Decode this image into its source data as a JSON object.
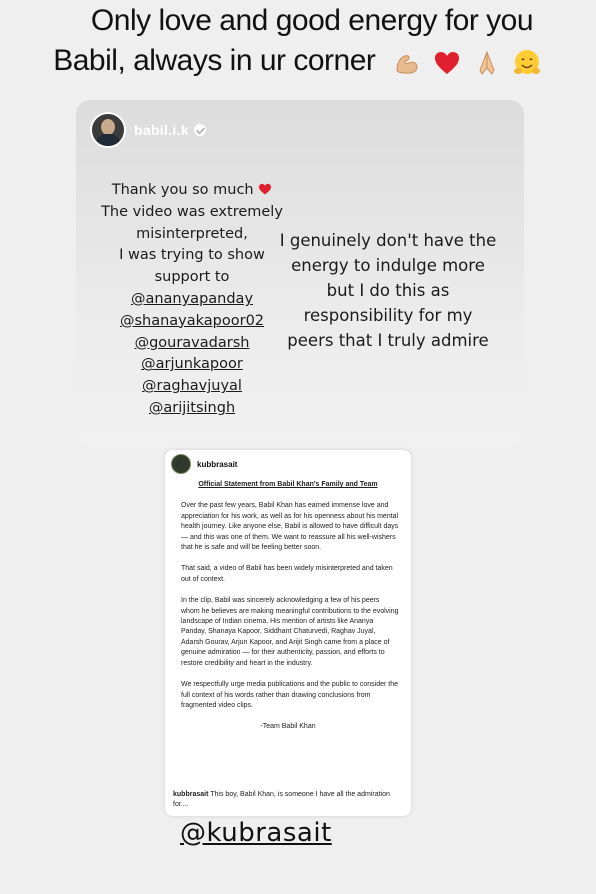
{
  "story": {
    "caption_line1": "Only love and good energy for you",
    "caption_line2": "Babil, always in ur corner",
    "emojis": [
      "flexed-biceps-icon",
      "red-heart-icon",
      "folded-hands-icon",
      "hugging-face-icon"
    ]
  },
  "shared_story": {
    "username": "babil.i.k",
    "left_message": {
      "lines": [
        "Thank you so much",
        "The video was extremely",
        "misinterpreted,",
        "I was trying to show",
        "support to"
      ],
      "mentions": [
        "@ananyapanday",
        "@shanayakapoor02",
        "@gouravadarsh",
        "@arjunkapoor",
        "@raghavjuyal",
        "@arijitsingh"
      ]
    },
    "right_message": [
      "I genuinely don't have the",
      "energy to indulge more",
      "but I do this as",
      "responsibility for my",
      "peers that I truly admire"
    ]
  },
  "post": {
    "username": "kubbrasait",
    "title": "Official Statement from Babil Khan's Family and Team",
    "paragraphs": [
      "Over the past few years, Babil Khan has earned immense love and appreciation for his work, as well as for his openness about his mental health journey. Like anyone else, Babil is allowed to have difficult days — and this was one of them. We want to reassure all his well-wishers that he is safe and will be feeling better soon.",
      "That said, a video of Babil has been widely misinterpreted and taken out of context.",
      "In the clip, Babil was sincerely acknowledging a few of his peers whom he believes are making meaningful contributions to the evolving landscape of Indian cinema. His mention of artists like Ananya Panday, Shanaya Kapoor, Siddhant Chaturvedi, Raghav Juyal, Adarsh Gourav, Arjun Kapoor, and Arijit Singh came from a place of genuine admiration — for their authenticity, passion, and efforts to restore credibility and heart in the industry.",
      "We respectfully urge media publications and the public to consider the full context of his words rather than drawing conclusions from fragmented video clips."
    ],
    "signature": "-Team Babil Khan",
    "caption_user": "kubbrasait",
    "caption_text": "This boy, Babil Khan, is someone I have all the admiration for...."
  },
  "bottom_mention": "@kubrasait"
}
